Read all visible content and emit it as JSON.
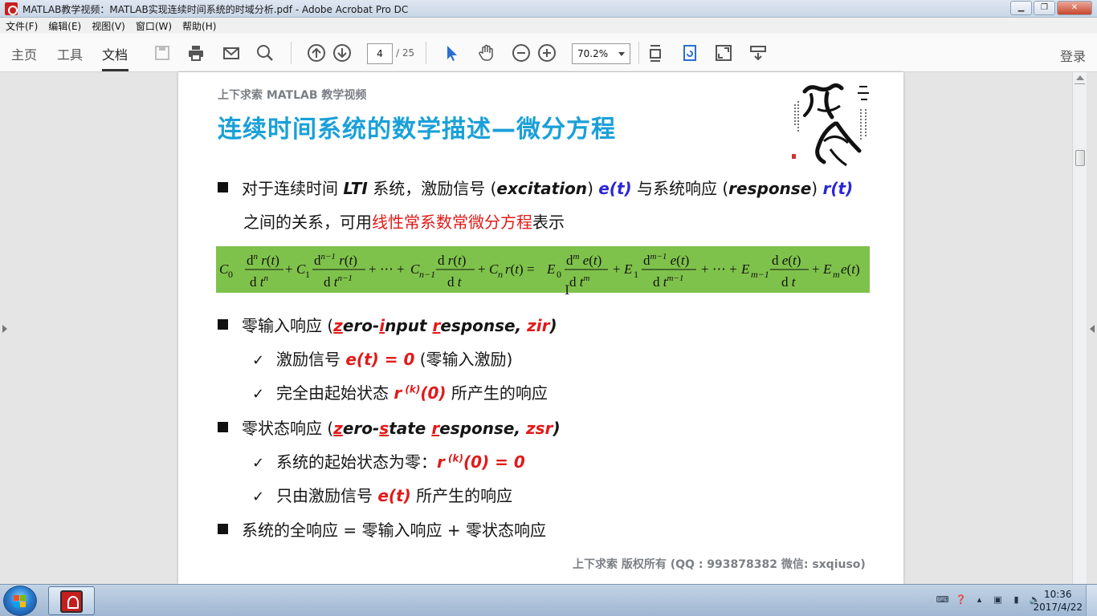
{
  "window": {
    "title": "MATLAB教学视频：MATLAB实现连续时间系统的时域分析.pdf - Adobe Acrobat Pro DC"
  },
  "menu": [
    "文件(F)",
    "编辑(E)",
    "视图(V)",
    "窗口(W)",
    "帮助(H)"
  ],
  "toolbar": {
    "tabs": {
      "home": "主页",
      "tools": "工具",
      "document": "文档"
    },
    "page_current": "4",
    "page_total": "/ 25",
    "zoom": "70.2%",
    "login": "登录"
  },
  "slide": {
    "header": "上下求索 MATLAB 教学视频",
    "title": "连续时间系统的数学描述—微分方程",
    "b1": {
      "t1": "对于连续时间 ",
      "lti": "LTI",
      "t2": " 系统，激励信号 (",
      "excitation": "excitation",
      "t3": ") ",
      "et": "e(t)",
      "t4": " 与系统响应 (",
      "response": "response",
      "t5": ") ",
      "rt": "r(t)",
      "line2a": "之间的关系，可用",
      "line2b": "线性常系数常微分方程",
      "line2c": "表示"
    },
    "b2": {
      "label": "零输入响应 (",
      "z": "z",
      "zp": "ero-",
      "i": "i",
      "ip": "nput ",
      "r": "r",
      "rp": "esponse, ",
      "abbr": "zir",
      "close": ")",
      "c1a": "激励信号 ",
      "c1b": "e(t) = 0",
      "c1c": " (零输入激励)",
      "c2a": "完全由起始状态 ",
      "c2b": "r",
      "c2sup": " (k)",
      "c2c": "(0)",
      "c2d": " 所产生的响应"
    },
    "b3": {
      "label": "零状态响应 (",
      "z": "z",
      "zp": "ero-",
      "s": "s",
      "sp": "tate ",
      "r": "r",
      "rp": "esponse, ",
      "abbr": "zsr",
      "close": ")",
      "c1a": "系统的起始状态为零：",
      "c1b": "r",
      "c1sup": " (k)",
      "c1c": "(0) = 0",
      "c2a": "只由激励信号 ",
      "c2b": "e(t)",
      "c2c": " 所产生的响应"
    },
    "b4": "系统的全响应 = 零输入响应 + 零状态响应",
    "footer": "上下求索  版权所有  (QQ : 993878382   微信: sxqiuso)",
    "equation_color": "#7fc24b"
  },
  "taskbar": {
    "time": "10:36",
    "date": "2017/4/22"
  },
  "colors": {
    "title_blue": "#1aa0d8",
    "red": "#e11a1a",
    "blue": "#2a27d4"
  }
}
